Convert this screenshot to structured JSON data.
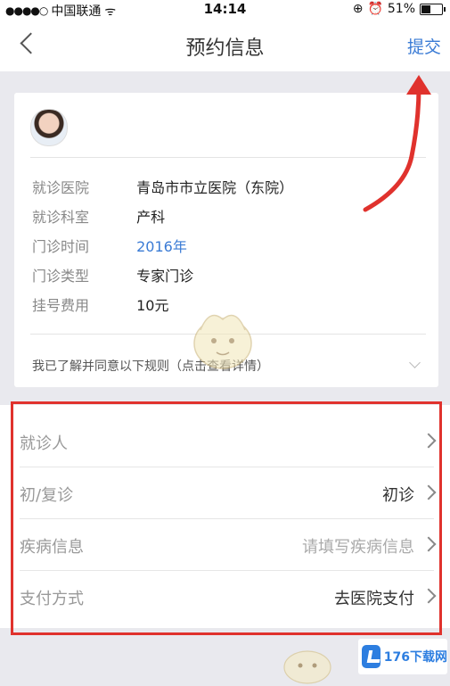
{
  "status_bar": {
    "carrier": "中国联通",
    "time": "14:14",
    "battery": "51%",
    "battery_level": 0.51
  },
  "nav": {
    "title": "预约信息",
    "submit_label": "提交",
    "back_icon": "chevron-left-icon"
  },
  "card": {
    "rows": [
      {
        "label": "就诊医院",
        "value": "青岛市市立医院（东院）"
      },
      {
        "label": "就诊科室",
        "value": "产科"
      },
      {
        "label": "门诊时间",
        "value": "2016年"
      },
      {
        "label": "门诊类型",
        "value": "专家门诊"
      },
      {
        "label": "挂号费用",
        "value": "10元"
      }
    ],
    "agree_text": "我已了解并同意以下规则（点击查看详情）"
  },
  "form": {
    "rows": [
      {
        "label": "就诊人",
        "value": ""
      },
      {
        "label": "初/复诊",
        "value": "初诊"
      },
      {
        "label": "疾病信息",
        "value": "请填写疾病信息"
      },
      {
        "label": "支付方式",
        "value": "去医院支付"
      }
    ]
  },
  "watermark": {
    "text": "176下载网"
  },
  "colors": {
    "accent": "#3a7bd5",
    "annotation": "#e0322d",
    "background": "#e9e9ee"
  }
}
